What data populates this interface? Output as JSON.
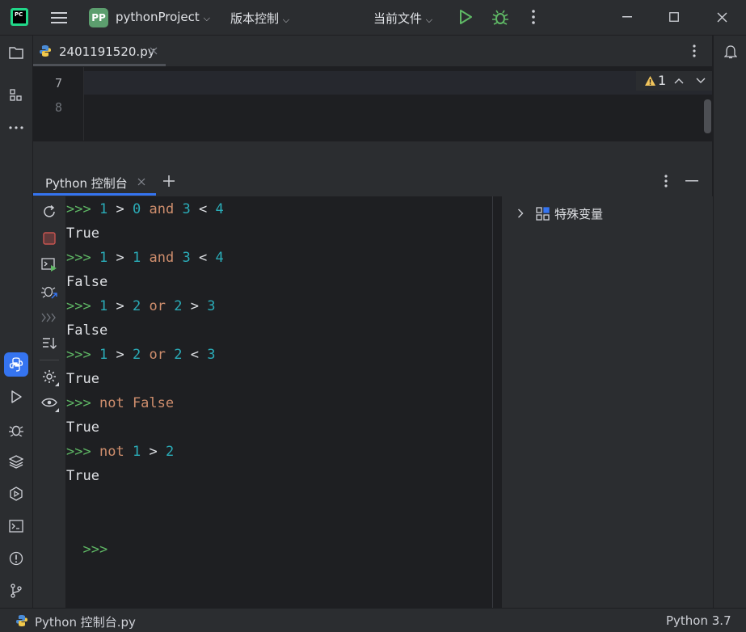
{
  "titlebar": {
    "app_logo": "PC",
    "project_badge": "PP",
    "project_name": "pythonProject",
    "vcs_label": "版本控制",
    "run_config": "当前文件",
    "run_color": "#5fb865",
    "debug_color": "#5fb865"
  },
  "editor": {
    "tab_name": "2401191520.py",
    "line_numbers": [
      "7",
      "8"
    ],
    "inspection_count": "1"
  },
  "console": {
    "tab_label": "Python 控制台",
    "lines": [
      {
        "type": "input",
        "prompt": ">>>",
        "parts": [
          [
            "n",
            "1"
          ],
          [
            "t",
            ">"
          ],
          [
            "n",
            "0"
          ],
          [
            "k",
            "and"
          ],
          [
            "n",
            "3"
          ],
          [
            "t",
            "<"
          ],
          [
            "n",
            "4"
          ]
        ]
      },
      {
        "type": "output",
        "text": "True"
      },
      {
        "type": "input",
        "prompt": ">>>",
        "parts": [
          [
            "n",
            "1"
          ],
          [
            "t",
            ">"
          ],
          [
            "n",
            "1"
          ],
          [
            "k",
            "and"
          ],
          [
            "n",
            "3"
          ],
          [
            "t",
            "<"
          ],
          [
            "n",
            "4"
          ]
        ]
      },
      {
        "type": "output",
        "text": "False"
      },
      {
        "type": "input",
        "prompt": ">>>",
        "parts": [
          [
            "n",
            "1"
          ],
          [
            "t",
            ">"
          ],
          [
            "n",
            "2"
          ],
          [
            "k",
            "or"
          ],
          [
            "n",
            "2"
          ],
          [
            "t",
            ">"
          ],
          [
            "n",
            "3"
          ]
        ]
      },
      {
        "type": "output",
        "text": "False"
      },
      {
        "type": "input",
        "prompt": ">>>",
        "parts": [
          [
            "n",
            "1"
          ],
          [
            "t",
            ">"
          ],
          [
            "n",
            "2"
          ],
          [
            "k",
            "or"
          ],
          [
            "n",
            "2"
          ],
          [
            "t",
            "<"
          ],
          [
            "n",
            "3"
          ]
        ]
      },
      {
        "type": "output",
        "text": "True"
      },
      {
        "type": "input",
        "prompt": ">>>",
        "parts": [
          [
            "k",
            "not"
          ],
          [
            "k",
            "False"
          ]
        ]
      },
      {
        "type": "output",
        "text": "True"
      },
      {
        "type": "input",
        "prompt": ">>>",
        "parts": [
          [
            "k",
            "not"
          ],
          [
            "n",
            "1"
          ],
          [
            "t",
            ">"
          ],
          [
            "n",
            "2"
          ]
        ]
      },
      {
        "type": "output",
        "text": "True"
      }
    ],
    "current_prompt": ">>>",
    "variables_label": "特殊变量"
  },
  "statusbar": {
    "left_label": "Python 控制台.py",
    "interpreter": "Python 3.7"
  },
  "colors": {
    "prompt": "#5fb865",
    "number": "#2aacb8",
    "keyword": "#cf8e6d",
    "accent": "#3574f0"
  }
}
